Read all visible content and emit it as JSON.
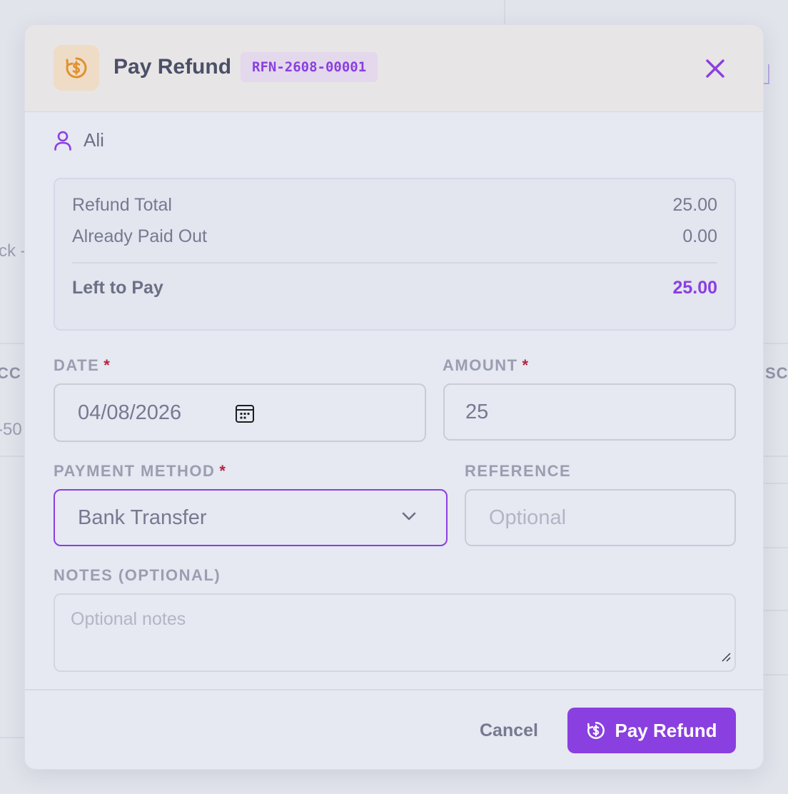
{
  "background": {
    "fragment_left_1": "ck -",
    "fragment_left_2": "CC",
    "fragment_left_3": "-50",
    "fragment_right_1": "SC"
  },
  "modal": {
    "header": {
      "icon": "refund-coin-icon",
      "title": "Pay Refund",
      "reference_badge": "RFN-2608-00001",
      "close_icon": "close-icon"
    },
    "customer": {
      "icon": "user-icon",
      "name": "Ali"
    },
    "summary": {
      "refund_total_label": "Refund Total",
      "refund_total_value": "25.00",
      "paid_out_label": "Already Paid Out",
      "paid_out_value": "0.00",
      "left_to_pay_label": "Left to Pay",
      "left_to_pay_value": "25.00"
    },
    "form": {
      "date_label": "DATE",
      "date_value": "04/08/2026",
      "amount_label": "AMOUNT",
      "amount_value": "25",
      "payment_method_label": "PAYMENT METHOD",
      "payment_method_value": "Bank Transfer",
      "reference_label": "REFERENCE",
      "reference_placeholder": "Optional",
      "notes_label": "NOTES (OPTIONAL)",
      "notes_placeholder": "Optional notes",
      "required_mark": "*"
    },
    "footer": {
      "cancel_label": "Cancel",
      "submit_label": "Pay Refund"
    }
  },
  "colors": {
    "accent": "#8a3fe0",
    "icon_orange": "#e0912f",
    "required": "#b3263f"
  }
}
